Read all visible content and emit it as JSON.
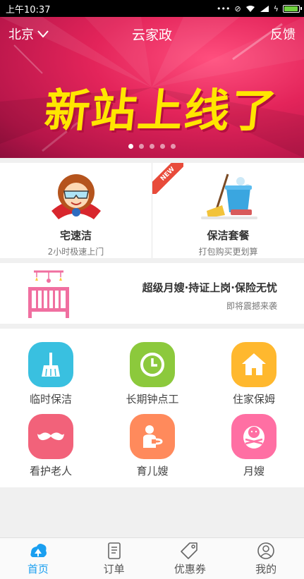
{
  "status_bar": {
    "time": "上午10:37",
    "icons": [
      "more-icon",
      "mute-icon",
      "wifi-icon",
      "signal-icon",
      "charging-icon",
      "battery-icon"
    ],
    "battery_level": 0.85
  },
  "header": {
    "city": "北京",
    "title": "云家政",
    "feedback": "反馈"
  },
  "banner": {
    "text_main": "新站上线了",
    "slide_count": 5,
    "active_slide": 1
  },
  "promos": [
    {
      "title": "宅速洁",
      "subtitle": "2小时极速上门",
      "icon": "super-cleaner-icon",
      "badge": ""
    },
    {
      "title": "保洁套餐",
      "subtitle": "打包购买更划算",
      "icon": "cleaning-bucket-icon",
      "badge": "NEW"
    }
  ],
  "maternity": {
    "title": "超级月嫂·持证上岗·保险无忧",
    "subtitle": "即将震撼来袭",
    "icon": "crib-icon"
  },
  "services": [
    {
      "label": "临时保洁",
      "icon": "broom-icon",
      "color": "#39c0e0"
    },
    {
      "label": "长期钟点工",
      "icon": "clock-icon",
      "color": "#8cc93c"
    },
    {
      "label": "住家保姆",
      "icon": "house-icon",
      "color": "#ffb82e"
    },
    {
      "label": "看护老人",
      "icon": "mustache-icon",
      "color": "#f2627a"
    },
    {
      "label": "育儿嫂",
      "icon": "nanny-icon",
      "color": "#ff8a5c"
    },
    {
      "label": "月嫂",
      "icon": "baby-icon",
      "color": "#ff6fa3"
    }
  ],
  "tabs": [
    {
      "label": "首页",
      "icon": "home-icon",
      "active": true
    },
    {
      "label": "订单",
      "icon": "order-icon",
      "active": false
    },
    {
      "label": "优惠券",
      "icon": "coupon-icon",
      "active": false
    },
    {
      "label": "我的",
      "icon": "profile-icon",
      "active": false
    }
  ],
  "colors": {
    "accent": "#1a9ff0",
    "banner": "#e3245a",
    "banner_text": "#ffe600"
  }
}
